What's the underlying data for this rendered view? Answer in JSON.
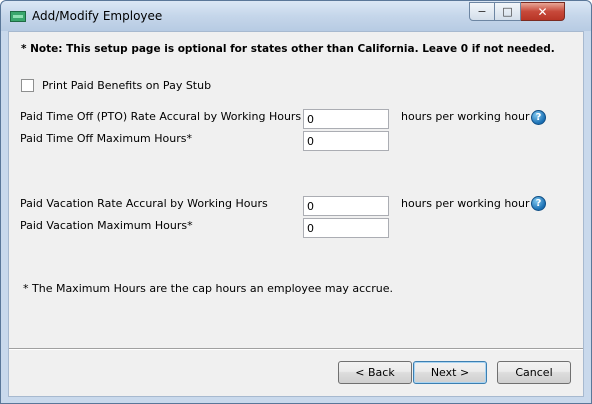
{
  "window": {
    "title": "Add/Modify Employee",
    "caption": {
      "minimize": "−",
      "maximize": "□",
      "close": "✕"
    }
  },
  "note": "* Note: This setup page is optional for states other than California. Leave 0 if not needed.",
  "print_paid_benefits": {
    "label": "Print Paid Benefits on Pay Stub",
    "checked": false
  },
  "pto": {
    "rate_label": "Paid Time Off (PTO) Rate Accural by Working Hours",
    "rate_value": "0",
    "rate_unit": "hours per working hour",
    "max_label": "Paid Time Off Maximum Hours*",
    "max_value": "0"
  },
  "vacation": {
    "rate_label": "Paid Vacation Rate Accural by Working Hours",
    "rate_value": "0",
    "rate_unit": "hours per working hour",
    "max_label": "Paid Vacation Maximum Hours*",
    "max_value": "0"
  },
  "help_icon_glyph": "?",
  "footnote": "* The Maximum Hours are the cap hours an employee may accrue.",
  "buttons": {
    "back": "< Back",
    "next": "Next >",
    "cancel": "Cancel"
  }
}
